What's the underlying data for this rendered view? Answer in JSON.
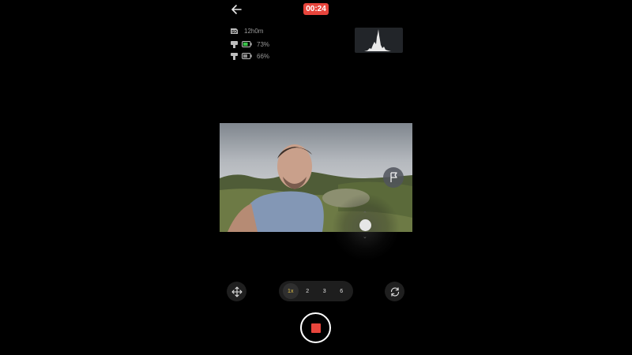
{
  "header": {
    "timer": "00:24",
    "timer_color": "#e8453c"
  },
  "stats": {
    "storage": {
      "icon": "sd-card-icon",
      "badge": "SD",
      "value": "12h0m"
    },
    "camera_battery": {
      "icon": "camera-icon",
      "value": "73%",
      "level": 0.73,
      "color": "#3ac24a"
    },
    "gimbal_battery": {
      "icon": "gimbal-icon",
      "value": "66%",
      "level": 0.66,
      "color": "#8a8a8a"
    }
  },
  "zoom": {
    "options": [
      "1x",
      "2",
      "3",
      "6"
    ],
    "selected": "1x",
    "selected_color": "#e2c247"
  },
  "icons": {
    "back": "arrow-left-icon",
    "flag": "flag-icon",
    "recenter": "move-arrows-icon",
    "flip": "rotate-camera-icon",
    "record": "stop-record-icon"
  }
}
